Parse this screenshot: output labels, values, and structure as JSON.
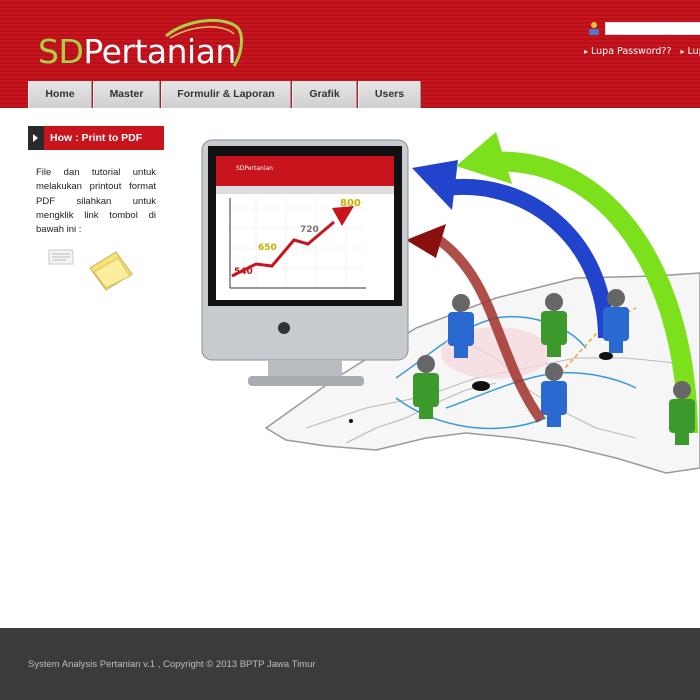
{
  "header": {
    "logo_sd": "SD",
    "logo_rest": "Pertanian",
    "login_placeholder": "",
    "links": [
      "Lupa Password??",
      "Lup"
    ]
  },
  "nav": {
    "items": [
      {
        "label": "Home"
      },
      {
        "label": "Master"
      },
      {
        "label": "Formulir & Laporan"
      },
      {
        "label": "Grafik"
      },
      {
        "label": "Users"
      }
    ]
  },
  "sidebar": {
    "title": "How : Print to PDF",
    "text": "File dan tutorial untuk melakukan printout format PDF silahkan untuk mengklik link tombol di bawah ini :"
  },
  "illustration": {
    "chart_values": [
      "540",
      "650",
      "720",
      "800"
    ],
    "screen_brand": "SDPertanian"
  },
  "footer": {
    "text": "System Analysis Pertanian v.1 , Copyright © 2013 BPTP Jawa Timur"
  },
  "colors": {
    "header_red": "#c8141c",
    "footer_dark": "#3b3b3b",
    "logo_green": "#a8d048"
  }
}
